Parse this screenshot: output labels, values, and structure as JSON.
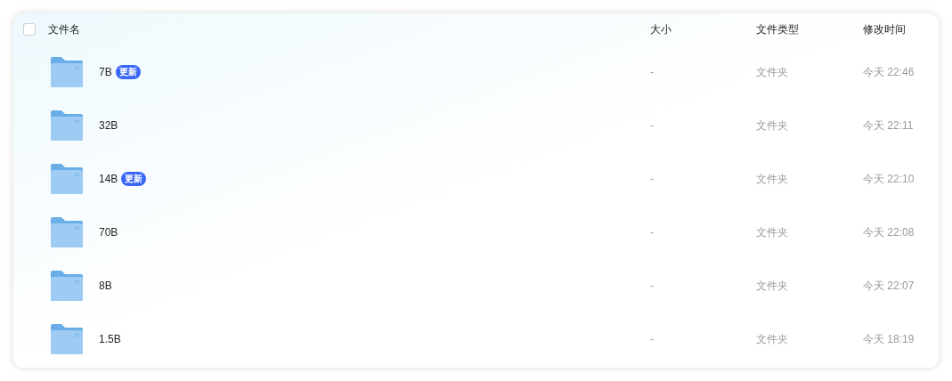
{
  "table": {
    "select_all": {
      "checked": false
    },
    "columns": [
      "文件名",
      "大小",
      "文件类型",
      "修改时间"
    ],
    "rows": [
      {
        "name": "7B",
        "badge": "更新",
        "size": "-",
        "type": "文件夹",
        "modified": "今天 22:46"
      },
      {
        "name": "32B",
        "size": "-",
        "type": "文件夹",
        "modified": "今天 22:11"
      },
      {
        "name": "14B",
        "badge": "更新",
        "size": "-",
        "type": "文件夹",
        "modified": "今天 22:10"
      },
      {
        "name": "70B",
        "size": "-",
        "type": "文件夹",
        "modified": "今天 22:08"
      },
      {
        "name": "8B",
        "size": "-",
        "type": "文件夹",
        "modified": "今天 22:07"
      },
      {
        "name": "1.5B",
        "size": "-",
        "type": "文件夹",
        "modified": "今天 18:19"
      }
    ]
  }
}
